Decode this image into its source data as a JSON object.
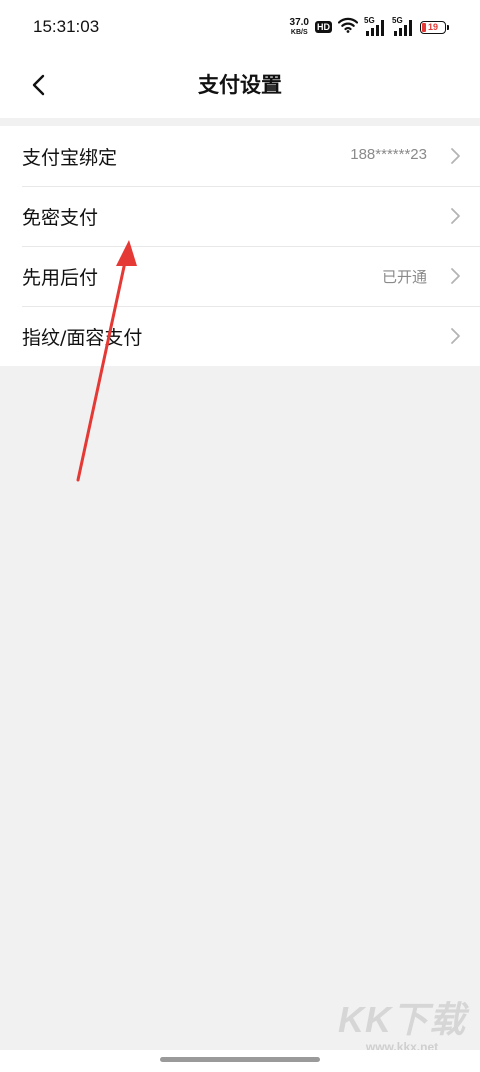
{
  "status_bar": {
    "time": "15:31:03",
    "net_speed": "37.0",
    "net_unit": "KB/S",
    "hd": "HD",
    "signal1_label": "5G",
    "signal2_label": "5G",
    "battery": "19",
    "battery_color": "#e53935"
  },
  "nav": {
    "title": "支付设置",
    "back_icon": "chevron-left-icon"
  },
  "settings": [
    {
      "label": "支付宝绑定",
      "value": "188******23"
    },
    {
      "label": "免密支付",
      "value": ""
    },
    {
      "label": "先用后付",
      "value": "已开通"
    },
    {
      "label": "指纹/面容支付",
      "value": ""
    }
  ],
  "annotation": {
    "type": "red-arrow",
    "color": "#e53935"
  },
  "watermark": {
    "big": "KK下载",
    "small": "www.kkx.net"
  }
}
